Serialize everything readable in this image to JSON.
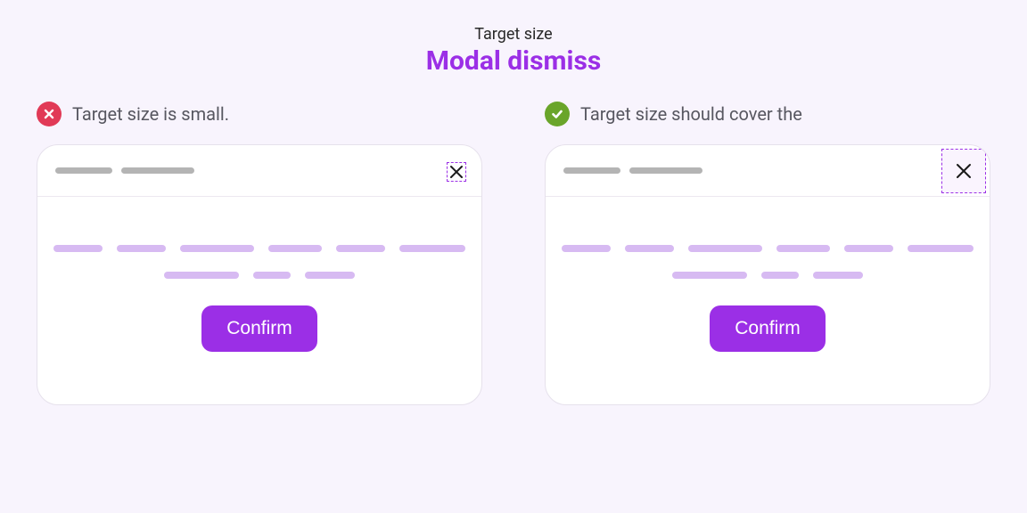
{
  "header": {
    "kicker": "Target size",
    "title": "Modal dismiss"
  },
  "examples": {
    "bad": {
      "caption": "Target size is small.",
      "confirm_label": "Confirm"
    },
    "good": {
      "caption": "Target size should cover the",
      "confirm_label": "Confirm"
    }
  }
}
